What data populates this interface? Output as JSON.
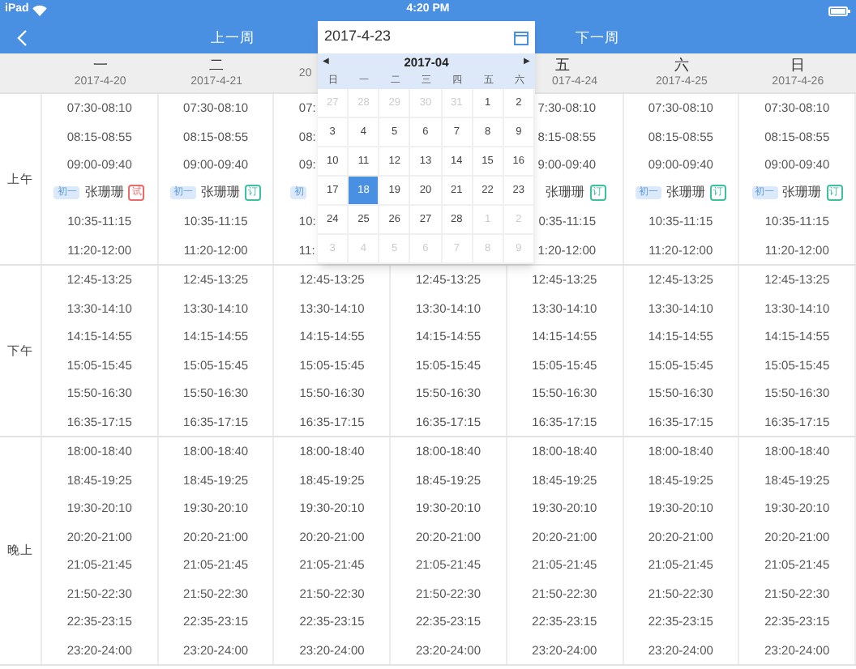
{
  "status_bar": {
    "device": "iPad",
    "time": "4:20 PM"
  },
  "nav": {
    "prev": "上一周",
    "next": "下一周"
  },
  "columns": [
    {
      "kind": "full",
      "day": "一",
      "date": "2017-4-20"
    },
    {
      "kind": "full",
      "day": "二",
      "date": "2017-4-21"
    },
    {
      "kind": "cut_end",
      "date": "20"
    },
    {
      "kind": "full"
    },
    {
      "kind": "cut_start",
      "day": "五",
      "date": "017-4-24"
    },
    {
      "kind": "full",
      "day": "六",
      "date": "2017-4-25"
    },
    {
      "kind": "full",
      "day": "日",
      "date": "2017-4-26"
    }
  ],
  "sections": [
    {
      "label": "上午",
      "rows": [
        [
          "07:30-08:10",
          "07:30-08:10",
          {
            "kind": "cut_end",
            "text": "07:"
          },
          null,
          {
            "kind": "cut_start",
            "text": "7:30-08:10"
          },
          "07:30-08:10",
          "07:30-08:10"
        ],
        [
          "08:15-08:55",
          "08:15-08:55",
          {
            "kind": "cut_end",
            "text": "08:"
          },
          null,
          {
            "kind": "cut_start",
            "text": "8:15-08:55"
          },
          "08:15-08:55",
          "08:15-08:55"
        ],
        [
          "09:00-09:40",
          "09:00-09:40",
          {
            "kind": "cut_end",
            "text": "09:"
          },
          null,
          {
            "kind": "cut_start",
            "text": "9:00-09:40"
          },
          "09:00-09:40",
          "09:00-09:40"
        ],
        [
          {
            "kind": "lesson",
            "grade": "初一",
            "name": "张珊珊",
            "tag": "试",
            "color": "#e86a6a"
          },
          {
            "kind": "lesson",
            "grade": "初一",
            "name": "张珊珊",
            "tag": "订",
            "color": "#3cc0a0"
          },
          {
            "kind": "lesson_cut_end",
            "grade": "初"
          },
          null,
          {
            "kind": "lesson_cut_start",
            "name": "张珊珊",
            "tag": "订",
            "color": "#3cc0a0"
          },
          {
            "kind": "lesson",
            "grade": "初一",
            "name": "张珊珊",
            "tag": "订",
            "color": "#3cc0a0"
          },
          {
            "kind": "lesson",
            "grade": "初一",
            "name": "张珊珊",
            "tag": "订",
            "color": "#3cc0a0"
          }
        ],
        [
          "10:35-11:15",
          "10:35-11:15",
          {
            "kind": "cut_end",
            "text": "10:"
          },
          null,
          {
            "kind": "cut_start",
            "text": "0:35-11:15"
          },
          "10:35-11:15",
          "10:35-11:15"
        ],
        [
          "11:20-12:00",
          "11:20-12:00",
          {
            "kind": "cut_end",
            "text": "11:"
          },
          null,
          {
            "kind": "cut_start",
            "text": "1:20-12:00"
          },
          "11:20-12:00",
          "11:20-12:00"
        ]
      ]
    },
    {
      "label": "下午",
      "rows": [
        [
          "12:45-13:25",
          "12:45-13:25",
          "12:45-13:25",
          "12:45-13:25",
          "12:45-13:25",
          "12:45-13:25",
          "12:45-13:25"
        ],
        [
          "13:30-14:10",
          "13:30-14:10",
          "13:30-14:10",
          "13:30-14:10",
          "13:30-14:10",
          "13:30-14:10",
          "13:30-14:10"
        ],
        [
          "14:15-14:55",
          "14:15-14:55",
          "14:15-14:55",
          "14:15-14:55",
          "14:15-14:55",
          "14:15-14:55",
          "14:15-14:55"
        ],
        [
          "15:05-15:45",
          "15:05-15:45",
          "15:05-15:45",
          "15:05-15:45",
          "15:05-15:45",
          "15:05-15:45",
          "15:05-15:45"
        ],
        [
          "15:50-16:30",
          "15:50-16:30",
          "15:50-16:30",
          "15:50-16:30",
          "15:50-16:30",
          "15:50-16:30",
          "15:50-16:30"
        ],
        [
          "16:35-17:15",
          "16:35-17:15",
          "16:35-17:15",
          "16:35-17:15",
          "16:35-17:15",
          "16:35-17:15",
          "16:35-17:15"
        ]
      ]
    },
    {
      "label": "晚上",
      "rows": [
        [
          "18:00-18:40",
          "18:00-18:40",
          "18:00-18:40",
          "18:00-18:40",
          "18:00-18:40",
          "18:00-18:40",
          "18:00-18:40"
        ],
        [
          "18:45-19:25",
          "18:45-19:25",
          "18:45-19:25",
          "18:45-19:25",
          "18:45-19:25",
          "18:45-19:25",
          "18:45-19:25"
        ],
        [
          "19:30-20:10",
          "19:30-20:10",
          "19:30-20:10",
          "19:30-20:10",
          "19:30-20:10",
          "19:30-20:10",
          "19:30-20:10"
        ],
        [
          "20:20-21:00",
          "20:20-21:00",
          "20:20-21:00",
          "20:20-21:00",
          "20:20-21:00",
          "20:20-21:00",
          "20:20-21:00"
        ],
        [
          "21:05-21:45",
          "21:05-21:45",
          "21:05-21:45",
          "21:05-21:45",
          "21:05-21:45",
          "21:05-21:45",
          "21:05-21:45"
        ],
        [
          "21:50-22:30",
          "21:50-22:30",
          "21:50-22:30",
          "21:50-22:30",
          "21:50-22:30",
          "21:50-22:30",
          "21:50-22:30"
        ],
        [
          "22:35-23:15",
          "22:35-23:15",
          "22:35-23:15",
          "22:35-23:15",
          "22:35-23:15",
          "22:35-23:15",
          "22:35-23:15"
        ],
        [
          "23:20-24:00",
          "23:20-24:00",
          "23:20-24:00",
          "23:20-24:00",
          "23:20-24:00",
          "23:20-24:00",
          "23:20-24:00"
        ]
      ]
    }
  ],
  "date_picker": {
    "value": "2017-4-23",
    "month": "2017-04",
    "prev": "◀",
    "next": "▶",
    "weekdays": [
      "日",
      "一",
      "二",
      "三",
      "四",
      "五",
      "六"
    ],
    "weeks": [
      [
        {
          "label": "27",
          "muted": true,
          "selected": false
        },
        {
          "label": "28",
          "muted": true,
          "selected": false
        },
        {
          "label": "29",
          "muted": true,
          "selected": false
        },
        {
          "label": "30",
          "muted": true,
          "selected": false
        },
        {
          "label": "31",
          "muted": true,
          "selected": false
        },
        {
          "label": "1",
          "muted": false,
          "selected": false
        },
        {
          "label": "2",
          "muted": false,
          "selected": false
        }
      ],
      [
        {
          "label": "3",
          "muted": false,
          "selected": false
        },
        {
          "label": "4",
          "muted": false,
          "selected": false
        },
        {
          "label": "5",
          "muted": false,
          "selected": false
        },
        {
          "label": "6",
          "muted": false,
          "selected": false
        },
        {
          "label": "7",
          "muted": false,
          "selected": false
        },
        {
          "label": "8",
          "muted": false,
          "selected": false
        },
        {
          "label": "9",
          "muted": false,
          "selected": false
        }
      ],
      [
        {
          "label": "10",
          "muted": false,
          "selected": false
        },
        {
          "label": "11",
          "muted": false,
          "selected": false
        },
        {
          "label": "12",
          "muted": false,
          "selected": false
        },
        {
          "label": "13",
          "muted": false,
          "selected": false
        },
        {
          "label": "14",
          "muted": false,
          "selected": false
        },
        {
          "label": "15",
          "muted": false,
          "selected": false
        },
        {
          "label": "16",
          "muted": false,
          "selected": false
        }
      ],
      [
        {
          "label": "17",
          "muted": false,
          "selected": false
        },
        {
          "label": "18",
          "muted": false,
          "selected": true
        },
        {
          "label": "19",
          "muted": false,
          "selected": false
        },
        {
          "label": "20",
          "muted": false,
          "selected": false
        },
        {
          "label": "21",
          "muted": false,
          "selected": false
        },
        {
          "label": "22",
          "muted": false,
          "selected": false
        },
        {
          "label": "23",
          "muted": false,
          "selected": false
        }
      ],
      [
        {
          "label": "24",
          "muted": false,
          "selected": false
        },
        {
          "label": "25",
          "muted": false,
          "selected": false
        },
        {
          "label": "26",
          "muted": false,
          "selected": false
        },
        {
          "label": "27",
          "muted": false,
          "selected": false
        },
        {
          "label": "28",
          "muted": false,
          "selected": false
        },
        {
          "label": "1",
          "muted": true,
          "selected": false
        },
        {
          "label": "2",
          "muted": true,
          "selected": false
        }
      ],
      [
        {
          "label": "3",
          "muted": true,
          "selected": false
        },
        {
          "label": "4",
          "muted": true,
          "selected": false
        },
        {
          "label": "5",
          "muted": true,
          "selected": false
        },
        {
          "label": "6",
          "muted": true,
          "selected": false
        },
        {
          "label": "7",
          "muted": true,
          "selected": false
        },
        {
          "label": "8",
          "muted": true,
          "selected": false
        },
        {
          "label": "9",
          "muted": true,
          "selected": false
        }
      ]
    ]
  }
}
